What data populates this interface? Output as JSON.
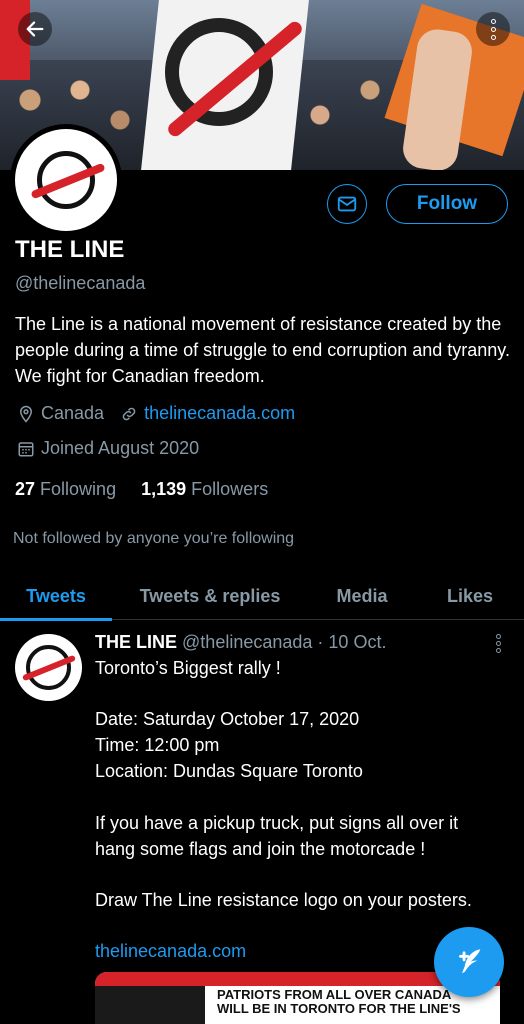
{
  "profile": {
    "name": "THE LINE",
    "handle": "@thelinecanada",
    "bio": "The Line is a national movement of resistance created by the people during a time of struggle to end corruption and tyranny. We fight for Canadian freedom.",
    "location": "Canada",
    "website": "thelinecanada.com",
    "joined": "Joined August 2020",
    "following_count": "27",
    "following_label": "Following",
    "followers_count": "1,139",
    "followers_label": "Followers",
    "not_followed_text": "Not followed by anyone you’re following"
  },
  "actions": {
    "follow_label": "Follow",
    "mail_icon": "mail-icon"
  },
  "tabs": [
    {
      "label": "Tweets",
      "active": true
    },
    {
      "label": "Tweets & replies",
      "active": false
    },
    {
      "label": "Media",
      "active": false
    },
    {
      "label": "Likes",
      "active": false
    }
  ],
  "tweet": {
    "author": "THE LINE",
    "handle": "@thelinecanada",
    "date": "· 10 Oct.",
    "lines": [
      "Toronto’s Biggest rally !",
      "",
      "Date: Saturday October 17, 2020",
      "Time: 12:00 pm",
      "Location: Dundas Square Toronto",
      "",
      "If you have a pickup truck, put signs all over it",
      "hang some flags and join the motorcade !",
      "",
      "Draw The Line resistance logo on your posters.",
      ""
    ],
    "link": "thelinecanada.com",
    "media_caption_1": "PATRIOTS FROM ALL OVER CANADA",
    "media_caption_2": "WILL BE IN TORONTO FOR THE LINE'S"
  },
  "colors": {
    "accent": "#1d9bf0",
    "background": "#000000",
    "muted": "#8899a6",
    "logo_red": "#d6232a"
  }
}
